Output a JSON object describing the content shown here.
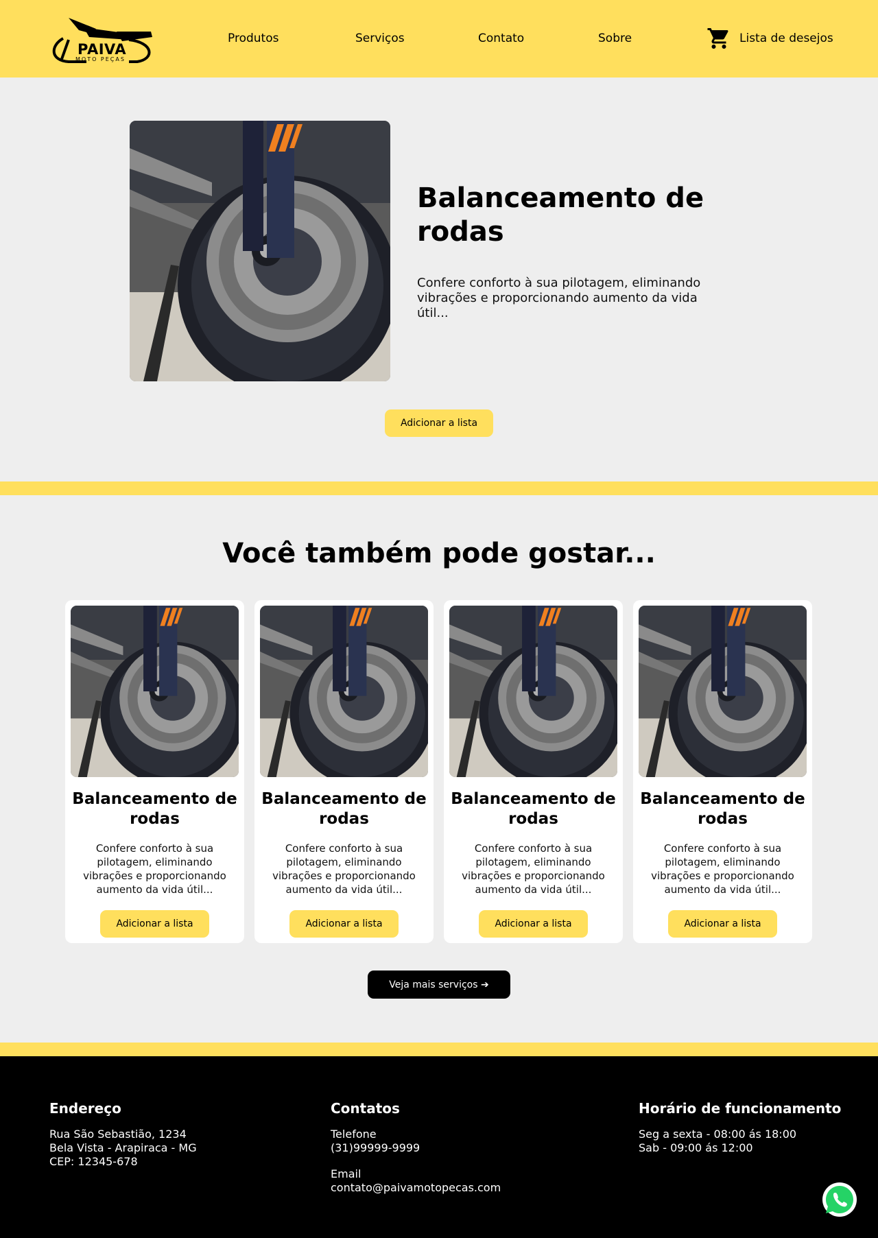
{
  "brand": {
    "name": "PAIVA",
    "tagline": "MOTO PEÇAS"
  },
  "nav": {
    "items": [
      "Produtos",
      "Serviços",
      "Contato",
      "Sobre"
    ],
    "wishlist_label": "Lista de desejos"
  },
  "hero": {
    "title": "Balanceamento de rodas",
    "description": "Confere conforto à sua pilotagem, eliminando vibrações e proporcionando aumento da vida útil...",
    "button_label": "Adicionar a lista"
  },
  "related": {
    "title": "Você também pode gostar...",
    "cards": [
      {
        "title": "Balanceamento de rodas",
        "description": "Confere conforto à sua pilotagem, eliminando vibrações e proporcionando aumento da vida útil...",
        "button_label": "Adicionar a lista"
      },
      {
        "title": "Balanceamento de rodas",
        "description": "Confere conforto à sua pilotagem, eliminando vibrações e proporcionando aumento da vida útil...",
        "button_label": "Adicionar a lista"
      },
      {
        "title": "Balanceamento de rodas",
        "description": "Confere conforto à sua pilotagem, eliminando vibrações e proporcionando aumento da vida útil...",
        "button_label": "Adicionar a lista"
      },
      {
        "title": "Balanceamento de rodas",
        "description": "Confere conforto à sua pilotagem, eliminando vibrações e proporcionando aumento da vida útil...",
        "button_label": "Adicionar a lista"
      }
    ],
    "more_button_label": "Veja mais serviços ➔"
  },
  "footer": {
    "address": {
      "title": "Endereço",
      "lines": [
        "Rua São Sebastião, 1234",
        "Bela Vista - Arapiraca - MG",
        "CEP: 12345-678"
      ]
    },
    "contacts": {
      "title": "Contatos",
      "phone_label": "Telefone",
      "phone": "(31)99999-9999",
      "email_label": "Email",
      "email": "contato@paivamotopecas.com"
    },
    "hours": {
      "title": "Horário de funcionamento",
      "lines": [
        "Seg a sexta - 08:00 ás 18:00",
        "Sab - 09:00 ás 12:00"
      ]
    }
  },
  "colors": {
    "accent": "#ffdf5d",
    "background": "#eeeeee",
    "footer": "#000000",
    "whatsapp": "#25d366"
  },
  "icons": {
    "cart": "cart-icon",
    "whatsapp": "whatsapp-icon",
    "logo": "motorcycle-logo-icon"
  }
}
